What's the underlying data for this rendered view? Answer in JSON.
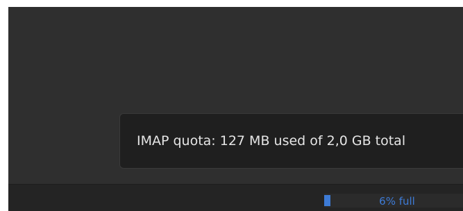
{
  "tooltip": {
    "text": "IMAP quota: 127 MB used of 2,0 GB total"
  },
  "statusbar": {
    "quota": {
      "label": "6% full",
      "fraction": 0.06
    }
  },
  "colors": {
    "window_bg": "#2f2f2f",
    "tooltip_bg": "#1f1f1f",
    "statusbar_bg": "#242424",
    "accent": "#3d7bd6",
    "text": "#e6e6e6"
  }
}
